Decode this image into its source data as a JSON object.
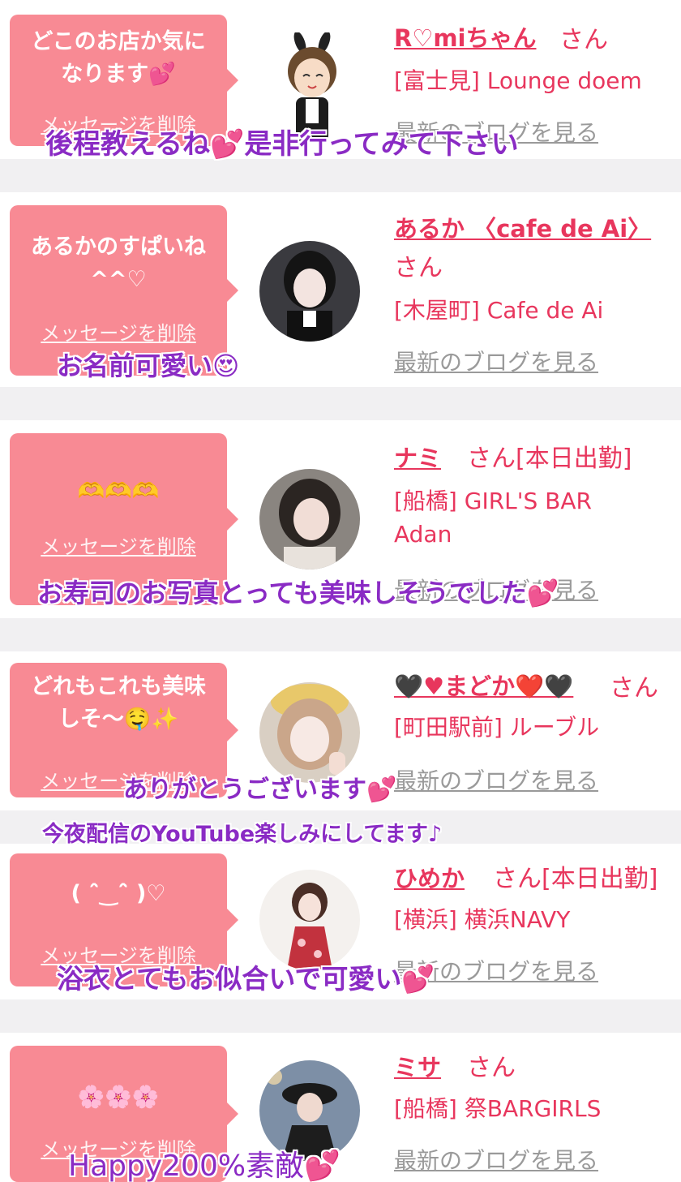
{
  "entries": [
    {
      "message": "どこのお店か気に\nなります💕",
      "delete_label": "メッセージを削除",
      "name": "R♡miちゃん",
      "san": "さん",
      "shop": "[富士見] Lounge doem",
      "blog": "最新のブログを見る",
      "caption": "後程教えるね💕是非行ってみて下さい"
    },
    {
      "message": "あるかのすぱいね\n^^♡",
      "delete_label": "メッセージを削除",
      "name": "あるか 〈cafe de Ai〉",
      "san": "さん",
      "shop": "[木屋町] Cafe de Ai",
      "blog": "最新のブログを見る",
      "caption": "お名前可愛い😍"
    },
    {
      "message": "🫶🫶🫶",
      "delete_label": "メッセージを削除",
      "name": "ナミ",
      "san": "さん[本日出勤]",
      "shop": "[船橋] GIRL'S BAR",
      "shop2": "Adan",
      "blog": "最新のブログを見る",
      "caption": "お寿司のお写真とっても美味しそうでした💕"
    },
    {
      "message": "どれもこれも美味\nしそ〜🤤✨",
      "delete_label": "メッセージを削除",
      "name": "🖤♥まどか❤️🖤",
      "san": "さん",
      "shop": "[町田駅前] ルーブル",
      "blog": "最新のブログを見る",
      "caption": "ありがとうございます💕",
      "caption2": "今夜配信のYouTube楽しみにしてます♪"
    },
    {
      "message": "( ˆ̑‿ˆ̑ )♡",
      "delete_label": "メッセージを削除",
      "name": "ひめか",
      "san": "さん[本日出勤]",
      "shop": "[横浜] 横浜NAVY",
      "blog": "最新のブログを見る",
      "caption": "浴衣とてもお似合いで可愛い💕"
    },
    {
      "message": "🌸🌸🌸",
      "delete_label": "メッセージを削除",
      "name": "ミサ",
      "san": "さん",
      "shop": "[船橋] 祭BARGIRLS",
      "blog": "最新のブログを見る",
      "caption": "Happy200%素敵💕"
    }
  ],
  "colors": {
    "bubble": "#f88a94",
    "accent": "#e8365d",
    "caption": "#8a2bc4",
    "link_gray": "#9a9a9a"
  }
}
